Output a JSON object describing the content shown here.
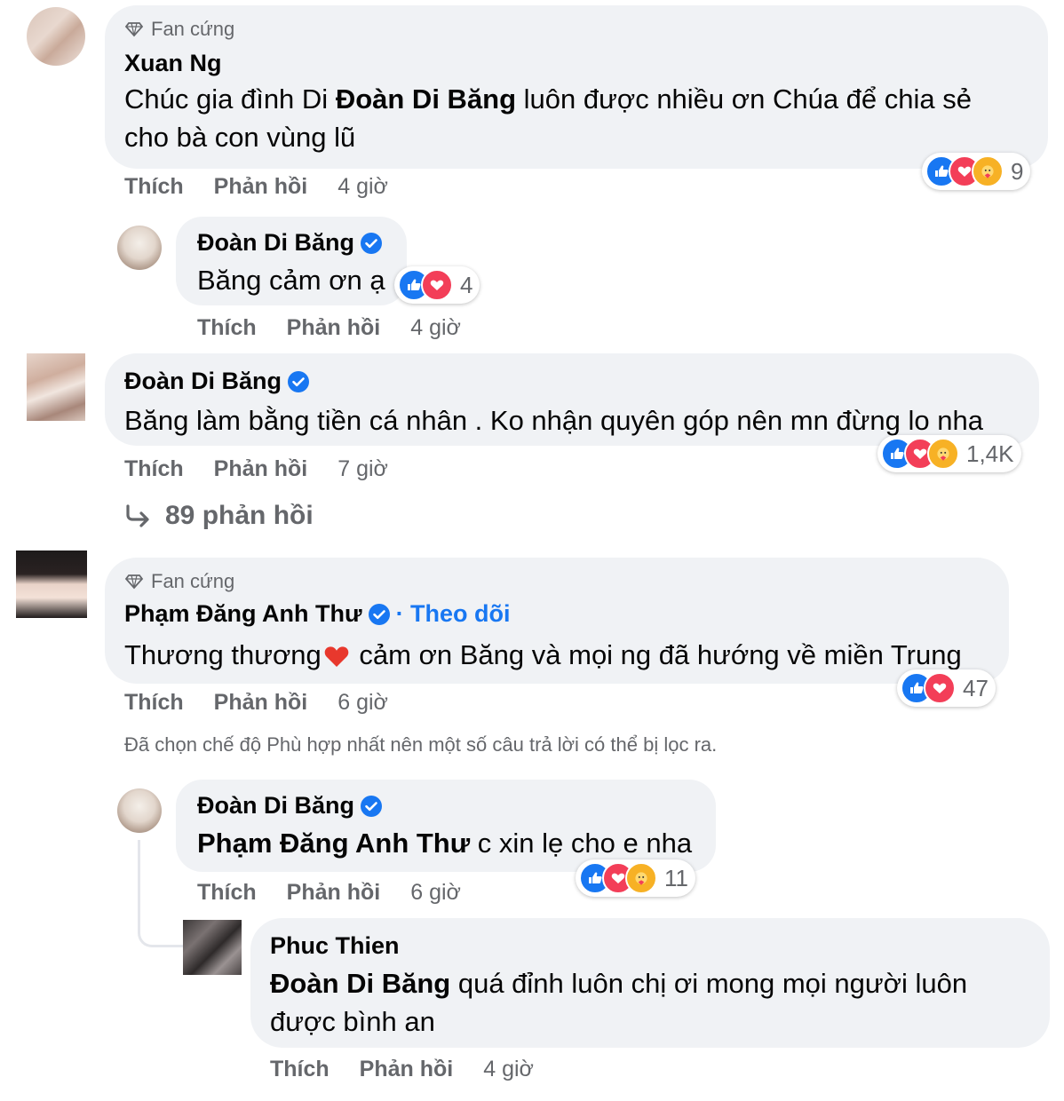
{
  "actions": {
    "like": "Thích",
    "reply": "Phản hồi"
  },
  "badge": {
    "label": "Fan cứng"
  },
  "comments": [
    {
      "badge": "Fan cứng",
      "author": "Xuan Ng",
      "text_before": "Chúc gia đình Di ",
      "mention": "Đoàn Di Băng",
      "text_after": " luôn được nhiều ơn Chúa để chia sẻ cho bà con vùng lũ",
      "time": "4 giờ",
      "reactions": [
        "like",
        "love",
        "care"
      ],
      "reaction_count": "9"
    },
    {
      "author": "Đoàn Di Băng",
      "verified": true,
      "text": "Băng cảm ơn ạ",
      "time": "4 giờ",
      "reactions": [
        "like",
        "love"
      ],
      "reaction_count": "4"
    },
    {
      "author": "Đoàn Di Băng",
      "verified": true,
      "text": "Băng làm bằng tiền cá nhân . Ko nhận quyên góp nên mn đừng lo nha",
      "time": "7 giờ",
      "reactions": [
        "like",
        "love",
        "care"
      ],
      "reaction_count": "1,4K"
    },
    {
      "badge": "Fan cứng",
      "author": "Phạm Đăng Anh Thư",
      "verified": true,
      "follow": "· Theo dõi",
      "text_before": "Thương thương",
      "text_after": " cảm ơn Băng và mọi ng đã hướng về miền Trung",
      "time": "6 giờ",
      "reactions": [
        "like",
        "love"
      ],
      "reaction_count": "47"
    },
    {
      "author": "Đoàn Di Băng",
      "verified": true,
      "mention": "Phạm Đăng Anh Thư",
      "text_after": " c xin lẹ cho e nha",
      "time": "6 giờ",
      "reactions": [
        "like",
        "love",
        "care"
      ],
      "reaction_count": "11"
    },
    {
      "author": "Phuc Thien",
      "mention": "Đoàn Di Băng",
      "text_after": " quá đỉnh luôn chị ơi mong mọi người luôn được bình an",
      "time": "4 giờ"
    }
  ],
  "more_replies": "89 phản hồi",
  "filter_note": "Đã chọn chế độ Phù hợp nhất nên một số câu trả lời có thể bị lọc ra.",
  "colors": {
    "bubble": "#f0f2f5",
    "like": "#1877f2",
    "love": "#f33e58",
    "care": "#f7b125",
    "muted": "#65676b"
  }
}
